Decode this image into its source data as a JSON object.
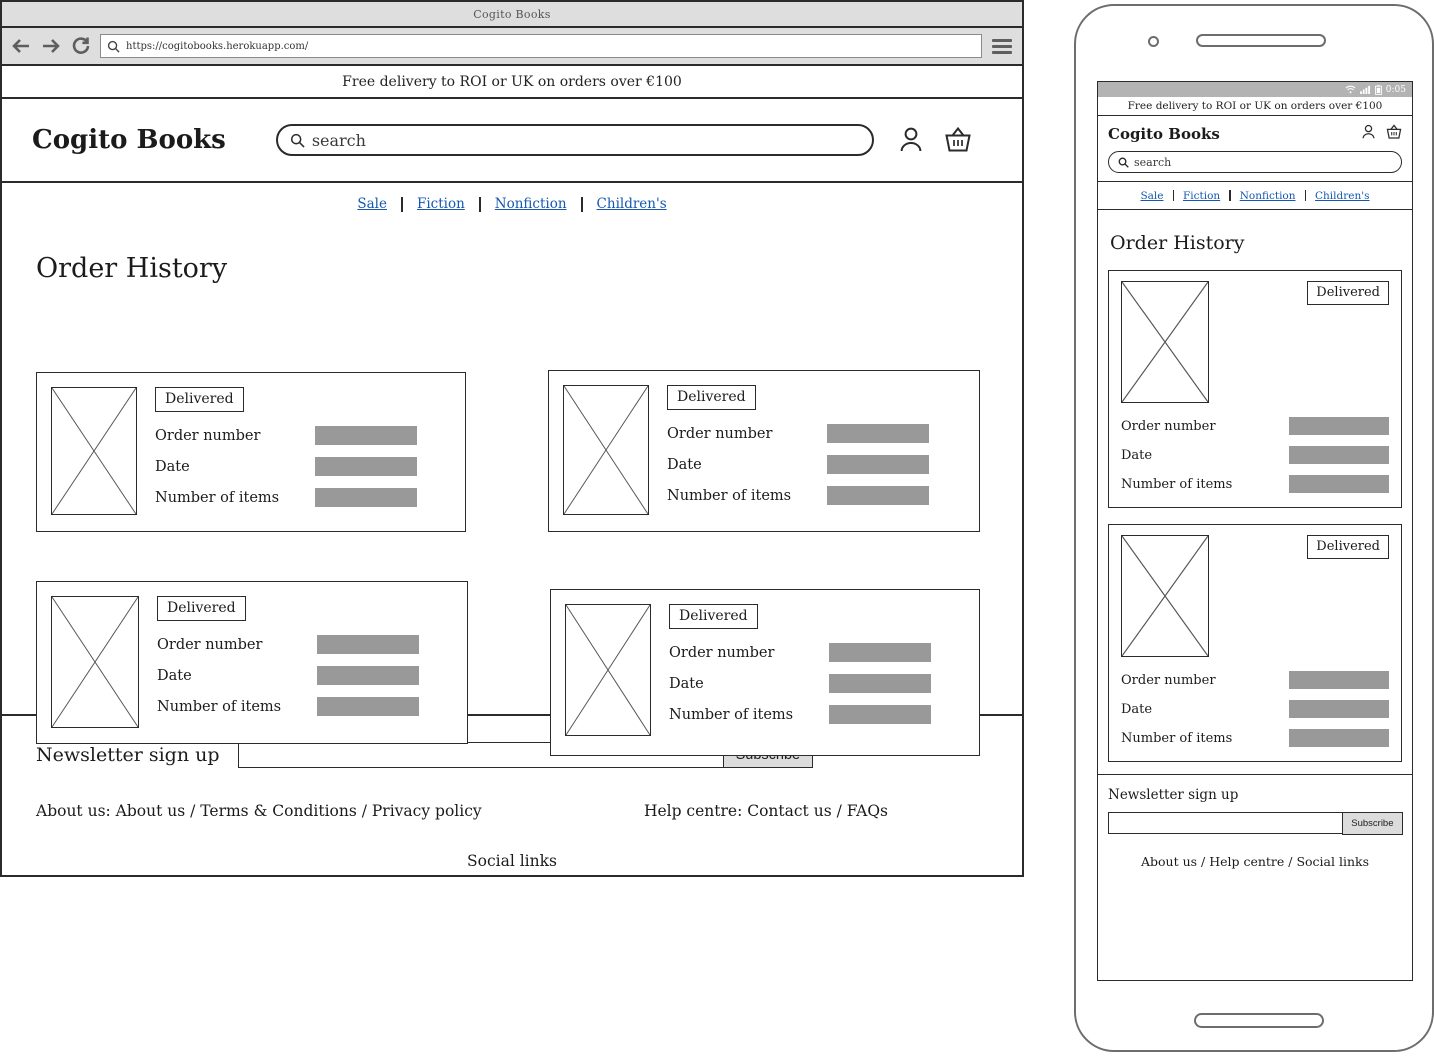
{
  "browser": {
    "window_title": "Cogito Books",
    "url": "https://cogitobooks.herokuapp.com/",
    "controls": {
      "back": "back-arrow-icon",
      "forward": "forward-arrow-icon",
      "reload": "reload-icon",
      "menu": "hamburger-menu-icon"
    }
  },
  "site": {
    "promo_banner": "Free delivery to ROI or UK on orders over €100",
    "brand": "Cogito Books",
    "search_placeholder": "search",
    "search_value": "",
    "account_icon": "user-account-icon",
    "cart_icon": "shopping-basket-icon",
    "nav": [
      {
        "label": "Sale"
      },
      {
        "label": "Fiction"
      },
      {
        "label": "Nonfiction"
      },
      {
        "label": "Children's"
      }
    ],
    "page_title": "Order History"
  },
  "orders": [
    {
      "status": "Delivered",
      "rows": [
        {
          "label": "Order number",
          "value": ""
        },
        {
          "label": "Date",
          "value": ""
        },
        {
          "label": "Number of items",
          "value": ""
        }
      ]
    },
    {
      "status": "Delivered",
      "rows": [
        {
          "label": "Order number",
          "value": ""
        },
        {
          "label": "Date",
          "value": ""
        },
        {
          "label": "Number of items",
          "value": ""
        }
      ]
    },
    {
      "status": "Delivered",
      "rows": [
        {
          "label": "Order number",
          "value": ""
        },
        {
          "label": "Date",
          "value": ""
        },
        {
          "label": "Number of items",
          "value": ""
        }
      ]
    },
    {
      "status": "Delivered",
      "rows": [
        {
          "label": "Order number",
          "value": ""
        },
        {
          "label": "Date",
          "value": ""
        },
        {
          "label": "Number of items",
          "value": ""
        }
      ]
    }
  ],
  "footer": {
    "newsletter_label": "Newsletter sign up",
    "newsletter_value": "",
    "subscribe_label": "Subscribe",
    "about_links": "About us: About us / Terms & Conditions / Privacy policy",
    "help_links": "Help centre: Contact us / FAQs",
    "social_links": "Social links"
  },
  "mobile": {
    "status_time": "0:05",
    "wifi_icon": "wifi-icon",
    "signal_icon": "signal-bars-icon",
    "battery_icon": "battery-icon",
    "promo_banner": "Free delivery to ROI or UK on orders over €100",
    "brand": "Cogito Books",
    "search_placeholder": "search",
    "page_title": "Order History",
    "orders": [
      {
        "status": "Delivered",
        "rows": [
          {
            "label": "Order number",
            "value": ""
          },
          {
            "label": "Date",
            "value": ""
          },
          {
            "label": "Number of items",
            "value": ""
          }
        ]
      },
      {
        "status": "Delivered",
        "rows": [
          {
            "label": "Order number",
            "value": ""
          },
          {
            "label": "Date",
            "value": ""
          },
          {
            "label": "Number of items",
            "value": ""
          }
        ]
      }
    ],
    "footer": {
      "newsletter_label": "Newsletter sign up",
      "subscribe_label": "Subscribe",
      "links": "About us / Help centre / Social links"
    }
  },
  "colors": {
    "placeholder_bar": "#999999",
    "link": "#1558b0",
    "chrome": "#dedede",
    "statusbar": "#b3b3b3",
    "button": "#dcdcdc"
  }
}
